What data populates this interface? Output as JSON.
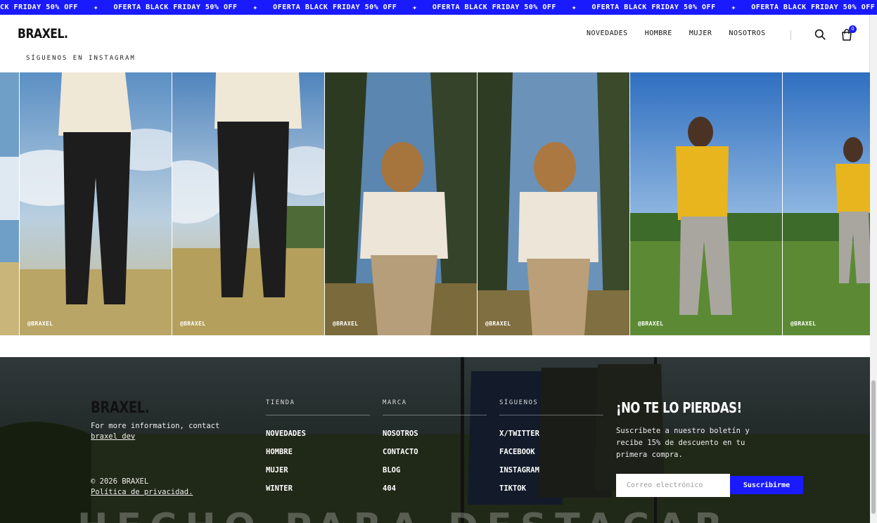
{
  "ticker": {
    "items": [
      "CK FRIDAY 50% OFF",
      "OFERTA BLACK FRIDAY 50% OFF",
      "OFERTA BLACK FRIDAY 50% OFF",
      "OFERTA BLACK FRIDAY 50% OFF",
      "OFERTA BLACK FRIDAY 50% OFF",
      "OFERTA BLACK FRIDAY 50% OFF"
    ],
    "separator": "✦",
    "bg_color": "#1a1aff"
  },
  "header": {
    "logo": "BRAXEL.",
    "nav": [
      "NOVEDADES",
      "HOMBRE",
      "MUJER",
      "NOSOTROS"
    ],
    "search_icon": "search-icon",
    "cart_icon": "cart-icon",
    "cart_count": "0"
  },
  "instagram": {
    "heading": "SÍGUENOS EN INSTAGRAM",
    "tiles": [
      {
        "handle": "",
        "scene": "sky"
      },
      {
        "handle": "@BRAXEL",
        "scene": "field"
      },
      {
        "handle": "@BRAXEL",
        "scene": "field"
      },
      {
        "handle": "@BRAXEL",
        "scene": "forest"
      },
      {
        "handle": "@BRAXEL",
        "scene": "forest"
      },
      {
        "handle": "@BRAXEL",
        "scene": "meadow"
      },
      {
        "handle": "@BRAXEL",
        "scene": "meadow"
      }
    ]
  },
  "footer": {
    "logo": "BRAXEL.",
    "contact_text": "For more information, contact",
    "contact_link": "braxel dev",
    "copyright": "© 2026 BRAXEL",
    "privacy_link": "Política de privacidad.",
    "columns": [
      {
        "title": "TIENDA",
        "items": [
          "NOVEDADES",
          "HOMBRE",
          "MUJER",
          "WINTER"
        ]
      },
      {
        "title": "MARCA",
        "items": [
          "NOSOTROS",
          "CONTACTO",
          "BLOG",
          "404"
        ]
      },
      {
        "title": "SÍGUENOS",
        "items": [
          "X/TWITTER",
          "FACEBOOK",
          "INSTAGRAM",
          "TIKTOK"
        ]
      }
    ],
    "newsletter": {
      "title": "¡NO TE LO PIERDAS!",
      "text": "Suscríbete a nuestro boletín y recibe 15% de descuento en tu primera compra.",
      "placeholder": "Correo electrónico",
      "button": "Suscribirme"
    },
    "background_text": "HECHO PARA DESTACAR"
  },
  "colors": {
    "accent": "#1a1aff",
    "footer_bg": "#3a4644"
  }
}
